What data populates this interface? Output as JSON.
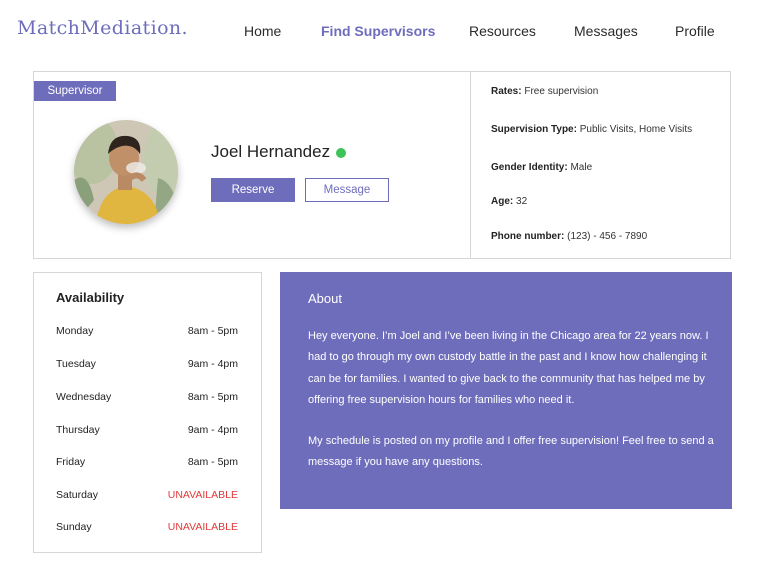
{
  "header": {
    "logo": "MatchMediation.",
    "nav": [
      {
        "label": "Home"
      },
      {
        "label": "Find Supervisors"
      },
      {
        "label": "Resources"
      },
      {
        "label": "Messages"
      },
      {
        "label": "Profile"
      }
    ],
    "active_nav": "Find Supervisors"
  },
  "profile": {
    "badge": "Supervisor",
    "name": "Joel Hernandez",
    "status": "online",
    "reserve_label": "Reserve",
    "message_label": "Message",
    "details": [
      {
        "label": "Rates:",
        "value": "Free supervision"
      },
      {
        "label": "Supervision Type:",
        "value": "Public Visits, Home Visits"
      },
      {
        "label": "Gender Identity:",
        "value": "Male"
      },
      {
        "label": "Age:",
        "value": "32"
      },
      {
        "label": "Phone number:",
        "value": "(123) - 456 - 7890"
      }
    ]
  },
  "availability": {
    "title": "Availability",
    "days": [
      {
        "day": "Monday",
        "hours": "8am - 5pm"
      },
      {
        "day": "Tuesday",
        "hours": "9am - 4pm"
      },
      {
        "day": "Wednesday",
        "hours": "8am - 5pm"
      },
      {
        "day": "Thursday",
        "hours": "9am - 4pm"
      },
      {
        "day": "Friday",
        "hours": "8am - 5pm"
      },
      {
        "day": "Saturday",
        "hours": "UNAVAILABLE"
      },
      {
        "day": "Sunday",
        "hours": "UNAVAILABLE"
      }
    ]
  },
  "about": {
    "title": "About",
    "paragraphs": [
      "Hey everyone. I’m Joel and I’ve been living in the Chicago area for 22 years now. I had to go through my own custody battle in the past and I know how challenging it can be for families. I wanted to give back to the community that has helped me by offering free supervision hours for families who need it.",
      "My schedule is posted on my profile and I offer free supervision! Feel free to send a message if you have any questions."
    ]
  },
  "colors": {
    "brand": "#6e6dbc",
    "online": "#3ec25a",
    "unavailable": "#e03a3a"
  }
}
